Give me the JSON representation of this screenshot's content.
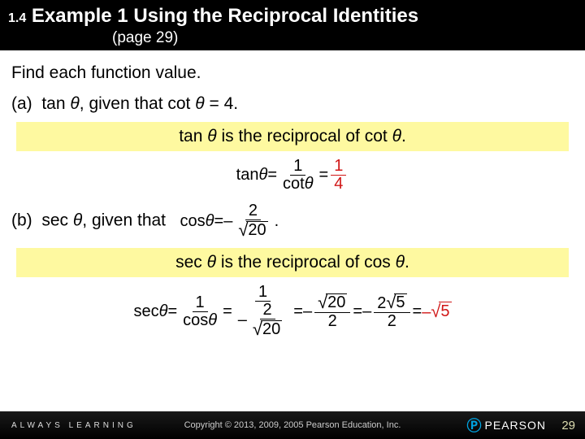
{
  "header": {
    "section_num": "1.4",
    "title_prefix": "Example 1",
    "title_rest": "Using the Reciprocal Identities",
    "page_ref": "(page 29)"
  },
  "instruction": "Find each function value.",
  "part_a": {
    "label": "(a)",
    "text_before": "tan",
    "theta1": "θ",
    "text_mid": ", given that cot",
    "theta2": "θ",
    "text_after": " = 4."
  },
  "note_a": {
    "before": "tan ",
    "theta1": "θ",
    "mid": " is the reciprocal of cot ",
    "theta2": "θ",
    "after": "."
  },
  "eq_a": {
    "lhs_fn": "tan",
    "theta": "θ",
    "eq": " = ",
    "f1_top": "1",
    "f1_bot_fn": "cot",
    "f1_bot_th": "θ",
    "eq2": " = ",
    "f2_top": "1",
    "f2_bot": "4"
  },
  "part_b": {
    "label": "(b)",
    "text_before": "sec",
    "theta1": "θ",
    "text_mid": ", given that",
    "cos_fn": "cos",
    "cos_th": "θ",
    "eq": " = ",
    "neg": "–",
    "f_top": "2",
    "rad": "20",
    "dot": "."
  },
  "note_b": {
    "before": "sec ",
    "theta1": "θ",
    "mid": " is the reciprocal of cos ",
    "theta2": "θ",
    "after": "."
  },
  "eq_b": {
    "lhs_fn": "sec",
    "theta": "θ",
    "eq": " = ",
    "f1_top": "1",
    "f1_bot_fn": "cos",
    "f1_bot_th": "θ",
    "eq2": " = ",
    "f2_top": "1",
    "neg": "–",
    "f2_bot_num": "2",
    "f2_bot_rad": "20",
    "eq3": " = ",
    "neg2": "–",
    "f3_top_rad": "20",
    "f3_bot": "2",
    "eq4": " = ",
    "neg3": "–",
    "f4_top_a": "2",
    "f4_top_rad": "5",
    "f4_bot": "2",
    "eq5": " = ",
    "neg4": "–",
    "rhs_rad": "5"
  },
  "footer": {
    "always": "ALWAYS LEARNING",
    "copyright": "Copyright © 2013, 2009, 2005 Pearson Education, Inc.",
    "brand": "PEARSON",
    "page": "29"
  }
}
